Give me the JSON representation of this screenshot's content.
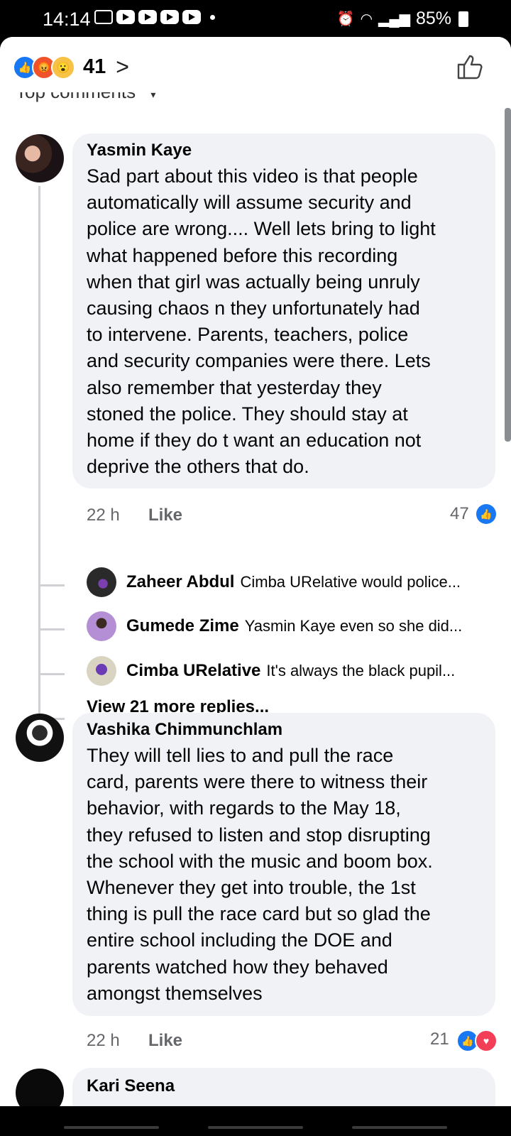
{
  "status_bar": {
    "time": "14:14",
    "notification_icons": [
      "download-icon",
      "youtube-icon",
      "youtube-icon",
      "youtube-icon",
      "youtube-icon"
    ],
    "battery": "85%"
  },
  "header": {
    "reactions": [
      "like",
      "angry",
      "wow"
    ],
    "reaction_count": "41",
    "chevron": ">",
    "sort_label": "Top comments"
  },
  "comments": [
    {
      "author": "Yasmin Kaye",
      "text": "Sad part about this video is that people\nautomatically will assume security and\npolice are wrong.... Well lets bring to light\nwhat happened before this recording\nwhen that girl was actually being unruly\ncausing chaos n they unfortunately had\nto intervene. Parents, teachers, police\nand security companies were there. Lets\nalso remember that yesterday they\nstoned the police. They should stay at\nhome if they do t want an education not\ndeprive the others that do.",
      "time": "22 h",
      "like_label": "Like",
      "reaction_count": "47",
      "replies": [
        {
          "name": "Zaheer Abdul",
          "text": "Cimba URelative would police..."
        },
        {
          "name": "Gumede Zime",
          "text": "Yasmin Kaye even so she did..."
        },
        {
          "name": "Cimba URelative",
          "text": "It's always the black pupil..."
        }
      ],
      "view_more": "View 21 more replies..."
    },
    {
      "author": "Vashika Chimmunchlam",
      "text": "They will tell lies to and pull the race\ncard, parents were there to witness their\nbehavior, with regards to the May 18,\nthey refused to listen and stop disrupting\nthe school with the music and boom box.\nWhenever they get into trouble, the 1st\nthing is pull the race card but so glad the\nentire school including the DOE and\nparents watched how they behaved\namongst themselves",
      "time": "22 h",
      "like_label": "Like",
      "reaction_count": "21"
    },
    {
      "author": "Kari Seena"
    }
  ],
  "colors": {
    "like_blue": "#1877f2",
    "love_red": "#f33e58",
    "bubble": "#f0f2f5",
    "meta_grey": "#65676b"
  }
}
